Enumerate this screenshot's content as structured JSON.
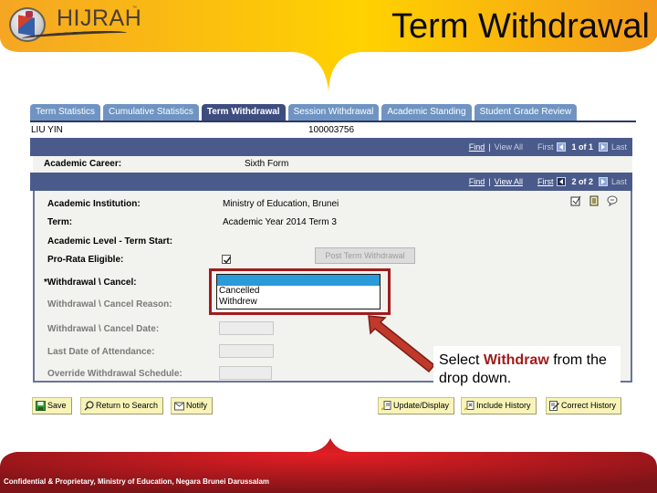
{
  "header": {
    "logo_text": "HIJRAH",
    "logo_tm": "™",
    "page_title": "Term Withdrawal"
  },
  "tabs": [
    {
      "label": "Term Statistics",
      "active": false
    },
    {
      "label": "Cumulative Statistics",
      "active": false
    },
    {
      "label": "Term Withdrawal",
      "active": true
    },
    {
      "label": "Session Withdrawal",
      "active": false
    },
    {
      "label": "Academic Standing",
      "active": false
    },
    {
      "label": "Student Grade Review",
      "active": false
    }
  ],
  "student": {
    "name": "LIU YIN",
    "id": "100003756"
  },
  "career_nav": {
    "find": "Find",
    "view_all": "View All",
    "first": "First",
    "count": "1 of 1",
    "last": "Last"
  },
  "career": {
    "label": "Academic Career:",
    "value": "Sixth Form"
  },
  "term_nav": {
    "find": "Find",
    "view_all": "View All",
    "first": "First",
    "count": "2 of 2",
    "last": "Last"
  },
  "fields": {
    "institution_label": "Academic Institution:",
    "institution_value": "Ministry of Education, Brunei",
    "term_label": "Term:",
    "term_value": "Academic Year 2014 Term 3",
    "level_label": "Academic Level - Term Start:",
    "prorata_label": "Pro-Rata Eligible:",
    "prorata_checked": true,
    "withdrawal_label": "*Withdrawal \\ Cancel:",
    "reason_label": "Withdrawal \\ Cancel Reason:",
    "date_label": "Withdrawal \\ Cancel Date:",
    "last_attendance_label": "Last Date of Attendance:",
    "override_label": "Override Withdrawal Schedule:",
    "post_button": "Post Term Withdrawal"
  },
  "dropdown": {
    "options": [
      "",
      "Cancelled",
      "Withdrew"
    ],
    "selected_index": 0
  },
  "callout": {
    "prefix": "Select ",
    "emphasis": "Withdraw",
    "suffix": " from the drop down."
  },
  "toolbar": {
    "save": "Save",
    "return_to_search": "Return to Search",
    "notify": "Notify",
    "update_display": "Update/Display",
    "include_history": "Include History",
    "correct_history": "Correct History"
  },
  "footer": {
    "text": "Confidential & Proprietary, Ministry of Education, Negara Brunei Darussalam"
  },
  "colors": {
    "banner_orange": "#f5a820",
    "tab_blue": "#6f94c2",
    "tab_active": "#3e4d80",
    "bar_navy": "#4a5a8a",
    "highlight_red": "#a01c1c",
    "footer_red": "#c81e24"
  }
}
